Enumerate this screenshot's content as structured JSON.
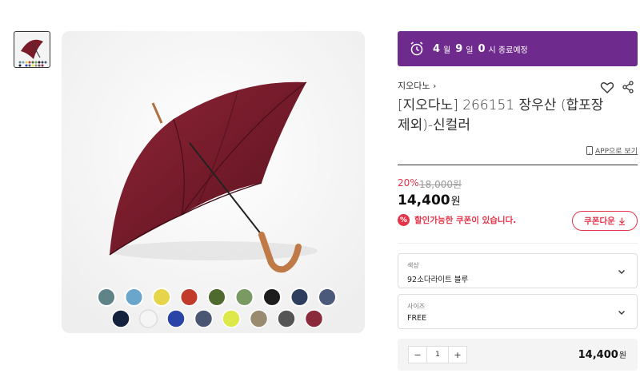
{
  "deal": {
    "month": "4",
    "month_unit": "월",
    "day": "9",
    "day_unit": "일",
    "hour": "0",
    "suffix": "시 종료예정"
  },
  "product": {
    "brand": "지오다노",
    "title": "[지오다노] 266151 장우산 (합포장제외)-신컬러",
    "app_link": "APP으로 보기"
  },
  "pricing": {
    "discount": "20%",
    "original": "18,000원",
    "price": "14,400",
    "price_unit": "원",
    "coupon_message": "할인가능한 쿠폰이 있습니다.",
    "coupon_button": "쿠폰다운"
  },
  "options": {
    "color_label": "색상",
    "color_value": "92소다라이트 블루",
    "size_label": "사이즈",
    "size_value": "FREE"
  },
  "quantity": {
    "count": "1",
    "minus": "−",
    "plus": "+",
    "total": "14,400",
    "total_unit": "원"
  },
  "colors": {
    "accent": "#6e2a8c",
    "sale": "#e4344a",
    "umbrella": "#7a1b2a",
    "swatches_row1": [
      "#5e8488",
      "#6aa6cc",
      "#e6d44a",
      "#c23a2a",
      "#4f6a2e",
      "#7a9a64",
      "#1d1d1d",
      "#2e3e5e",
      "#4a5a7a"
    ],
    "swatches_row2": [
      "#15223e",
      "#f5f5f5",
      "#2b44a8",
      "#4a5672",
      "#dde84a",
      "#9a8a70",
      "#555555",
      "#8a2a3a"
    ]
  }
}
